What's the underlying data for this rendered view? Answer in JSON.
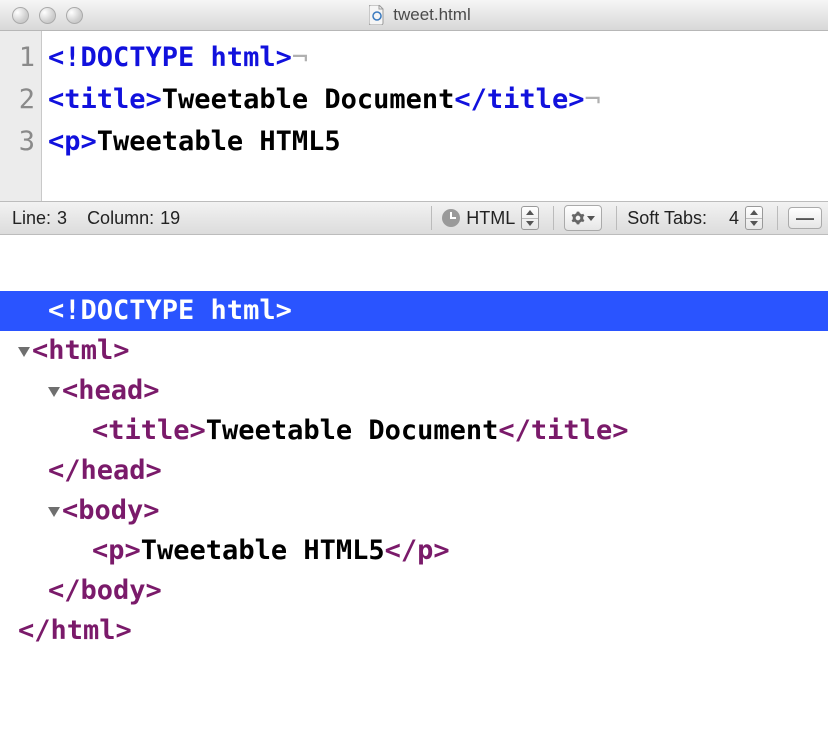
{
  "window": {
    "title": "tweet.html"
  },
  "editor": {
    "lines": [
      {
        "n": "1",
        "tokens": [
          {
            "k": "tag",
            "v": "<!DOCTYPE html>"
          },
          {
            "k": "invis",
            "v": "¬"
          }
        ]
      },
      {
        "n": "2",
        "tokens": [
          {
            "k": "tag",
            "v": "<title>"
          },
          {
            "k": "text",
            "v": "Tweetable Document"
          },
          {
            "k": "tag",
            "v": "</title>"
          },
          {
            "k": "invis",
            "v": "¬"
          }
        ]
      },
      {
        "n": "3",
        "tokens": [
          {
            "k": "tag",
            "v": "<p>"
          },
          {
            "k": "text",
            "v": "Tweetable HTML5"
          }
        ]
      }
    ]
  },
  "status": {
    "line_label": "Line:",
    "line_value": "3",
    "col_label": "Column:",
    "col_value": "19",
    "language": "HTML",
    "soft_tabs_label": "Soft Tabs:",
    "soft_tabs_value": "4"
  },
  "inspector": {
    "rows": [
      {
        "indent": "hl",
        "disclosure": false,
        "parts": [
          {
            "k": "tag",
            "v": "<!DOCTYPE html>"
          }
        ]
      },
      {
        "indent": "ind0",
        "disclosure": true,
        "parts": [
          {
            "k": "tag",
            "v": "<html>"
          }
        ]
      },
      {
        "indent": "ind1",
        "disclosure": true,
        "parts": [
          {
            "k": "tag",
            "v": "<head>"
          }
        ]
      },
      {
        "indent": "ind2",
        "disclosure": false,
        "parts": [
          {
            "k": "tag",
            "v": "<title>"
          },
          {
            "k": "txt",
            "v": "Tweetable Document"
          },
          {
            "k": "tag",
            "v": "</title>"
          }
        ]
      },
      {
        "indent": "ind1",
        "disclosure": false,
        "parts": [
          {
            "k": "tag",
            "v": "</head>"
          }
        ]
      },
      {
        "indent": "ind1",
        "disclosure": true,
        "parts": [
          {
            "k": "tag",
            "v": "<body>"
          }
        ]
      },
      {
        "indent": "ind2",
        "disclosure": false,
        "parts": [
          {
            "k": "tag",
            "v": "<p>"
          },
          {
            "k": "txt",
            "v": "Tweetable HTML5"
          },
          {
            "k": "tag",
            "v": "</p>"
          }
        ]
      },
      {
        "indent": "ind1",
        "disclosure": false,
        "parts": [
          {
            "k": "tag",
            "v": "</body>"
          }
        ]
      },
      {
        "indent": "ind0",
        "disclosure": false,
        "parts": [
          {
            "k": "tag",
            "v": "</html>"
          }
        ]
      }
    ]
  }
}
